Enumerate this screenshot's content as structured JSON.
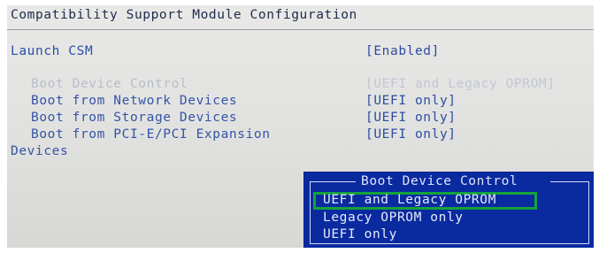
{
  "page": {
    "title": "Compatibility Support Module Configuration"
  },
  "settings": [
    {
      "label": "Launch CSM",
      "value": "[Enabled]"
    },
    {
      "label": "Boot Device Control",
      "value": "[UEFI and Legacy OPROM]"
    },
    {
      "label": "Boot from Network Devices",
      "value": "[UEFI only]"
    },
    {
      "label": "Boot from Storage Devices",
      "value": "[UEFI only]"
    },
    {
      "label": "Boot from PCI-E/PCI Expansion",
      "label_wrap": "Devices",
      "value": "[UEFI only]"
    }
  ],
  "popup": {
    "title": "Boot Device Control",
    "options": [
      "UEFI and Legacy OPROM",
      "Legacy OPROM only",
      "UEFI only"
    ],
    "selected_index": 0,
    "highlight_color": "#14a33b",
    "background_color": "#0a2aa0"
  }
}
